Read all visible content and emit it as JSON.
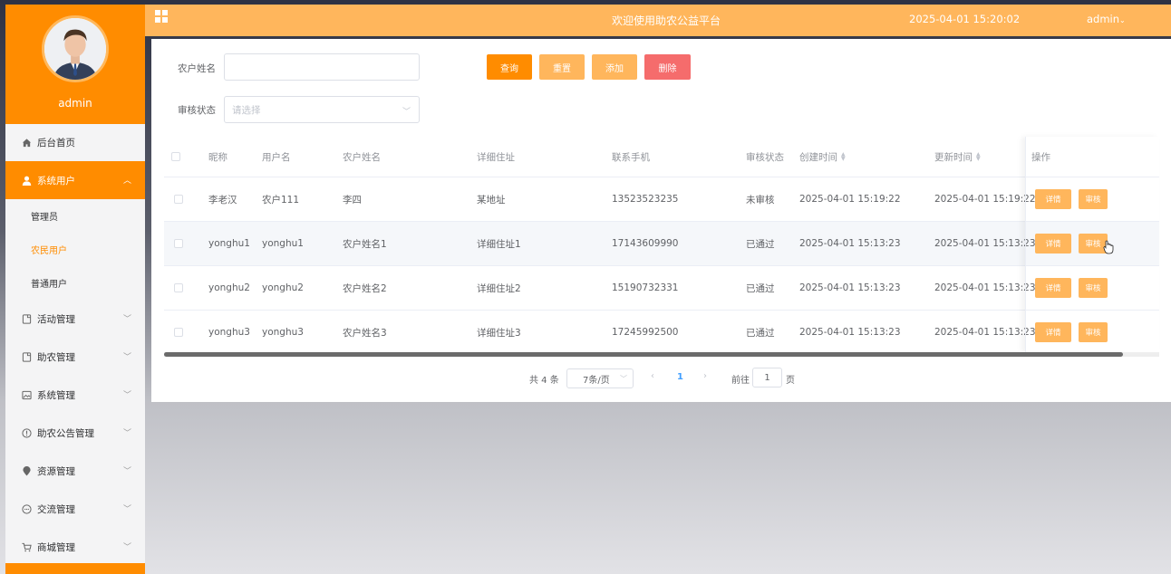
{
  "sidebar": {
    "username": "admin",
    "menu": [
      {
        "label": "后台首页",
        "icon": "home-icon"
      },
      {
        "label": "系统用户",
        "icon": "user-icon"
      },
      {
        "label": "活动管理",
        "icon": "document-icon"
      },
      {
        "label": "助农管理",
        "icon": "document-icon"
      },
      {
        "label": "系统管理",
        "icon": "image-icon"
      },
      {
        "label": "助农公告管理",
        "icon": "info-icon"
      },
      {
        "label": "资源管理",
        "icon": "location-icon"
      },
      {
        "label": "交流管理",
        "icon": "chat-icon"
      },
      {
        "label": "商城管理",
        "icon": "cart-icon"
      }
    ],
    "submenu": [
      {
        "label": "管理员"
      },
      {
        "label": "农民用户"
      },
      {
        "label": "普通用户"
      }
    ]
  },
  "header": {
    "title": "欢迎使用助农公益平台",
    "datetime": "2025-04-01 15:20:02",
    "user": "admin"
  },
  "search": {
    "name_label": "农户姓名",
    "name_value": "",
    "status_label": "审核状态",
    "status_placeholder": "请选择",
    "query_btn": "查询",
    "reset_btn": "重置",
    "add_btn": "添加",
    "delete_btn": "删除"
  },
  "table": {
    "columns": [
      "昵称",
      "用户名",
      "农户姓名",
      "详细住址",
      "联系手机",
      "审核状态",
      "创建时间",
      "更新时间",
      "操作"
    ],
    "rows": [
      {
        "nickname": "李老汉",
        "username": "农户111",
        "name": "李四",
        "address": "某地址",
        "phone": "13523523235",
        "status": "未审核",
        "created": "2025-04-01 15:19:22",
        "updated": "2025-04-01 15:19:22"
      },
      {
        "nickname": "yonghu1",
        "username": "yonghu1",
        "name": "农户姓名1",
        "address": "详细住址1",
        "phone": "17143609990",
        "status": "已通过",
        "created": "2025-04-01 15:13:23",
        "updated": "2025-04-01 15:13:23"
      },
      {
        "nickname": "yonghu2",
        "username": "yonghu2",
        "name": "农户姓名2",
        "address": "详细住址2",
        "phone": "15190732331",
        "status": "已通过",
        "created": "2025-04-01 15:13:23",
        "updated": "2025-04-01 15:13:23"
      },
      {
        "nickname": "yonghu3",
        "username": "yonghu3",
        "name": "农户姓名3",
        "address": "详细住址3",
        "phone": "17245992500",
        "status": "已通过",
        "created": "2025-04-01 15:13:23",
        "updated": "2025-04-01 15:13:23"
      }
    ],
    "detail_btn": "详情",
    "audit_btn": "审核"
  },
  "pagination": {
    "total": "共 4 条",
    "page_size": "7条/页",
    "current": "1",
    "goto_label": "前往",
    "goto_value": "1",
    "page_suffix": "页"
  },
  "colors": {
    "accent": "#ff8c00",
    "header": "#ffb65c",
    "button_light": "#ffb65c",
    "danger": "#f56c6c",
    "page_link": "#409eff"
  }
}
